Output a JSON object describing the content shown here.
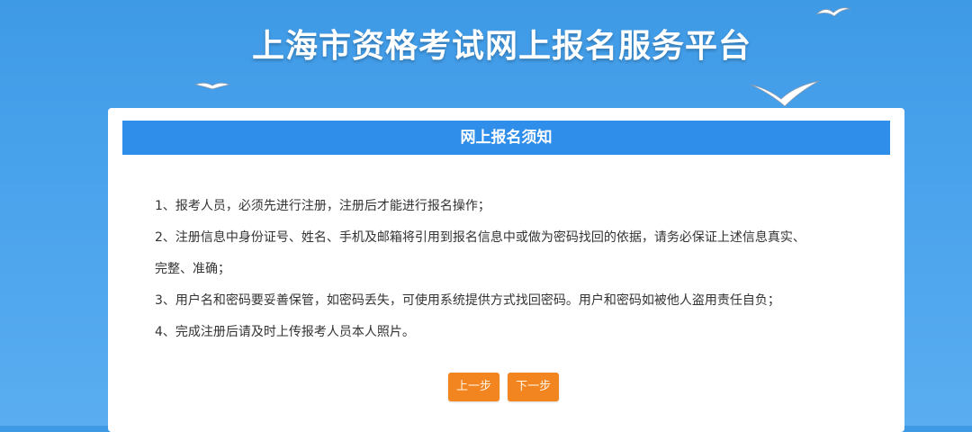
{
  "site": {
    "title": "上海市资格考试网上报名服务平台"
  },
  "notice": {
    "heading": "网上报名须知",
    "items": [
      "1、报考人员，必须先进行注册，注册后才能进行报名操作；",
      "2、注册信息中身份证号、姓名、手机及邮箱将引用到报名信息中或做为密码找回的依据，请务必保证上述信息真实、",
      "完整、准确；",
      "3、用户名和密码要妥善保管，如密码丢失，可使用系统提供方式找回密码。用户和密码如被他人盗用责任自负；",
      "4、完成注册后请及时上传报考人员本人照片。"
    ]
  },
  "buttons": {
    "prev_label": "上一步",
    "next_label": "下一步"
  },
  "colors": {
    "background": "#4aa3ec",
    "header_bar": "#2f8eea",
    "button": "#f2851f"
  }
}
